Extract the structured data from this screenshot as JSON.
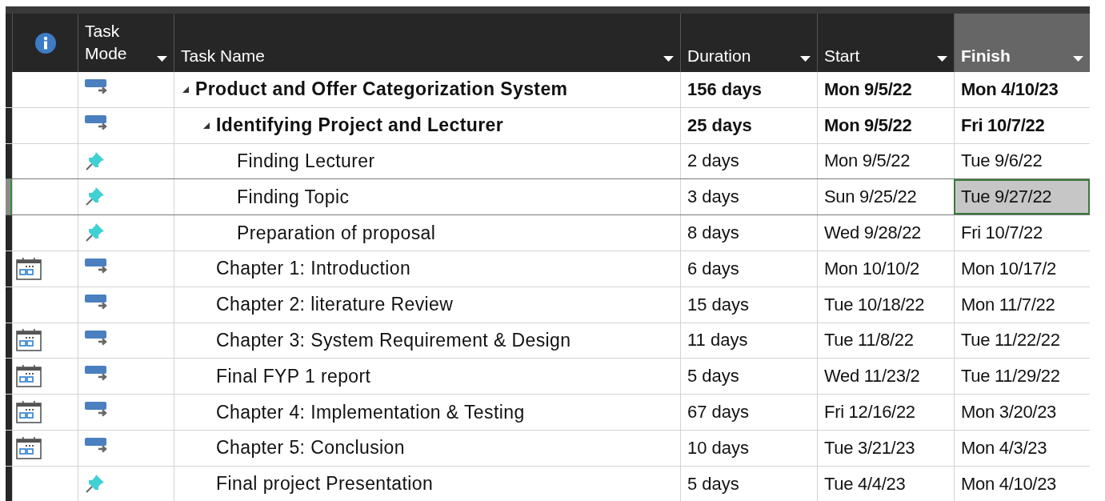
{
  "columns": [
    {
      "kind": "indicators",
      "selected": false
    },
    {
      "kind": "mode",
      "label": "Task Mode",
      "filter": true,
      "selected": false
    },
    {
      "kind": "name",
      "label": "Task Name",
      "filter": true,
      "selected": false
    },
    {
      "kind": "duration",
      "label": "Duration",
      "filter": true,
      "selected": false
    },
    {
      "kind": "start",
      "label": "Start",
      "filter": true,
      "selected": false
    },
    {
      "kind": "finish",
      "label": "Finish",
      "filter": true,
      "selected": true
    }
  ],
  "rows": [
    {
      "manual": false,
      "name": "Product and Offer Categorization System",
      "duration": "156 days",
      "start": "Mon 9/5/22",
      "finish": "Mon 4/10/23",
      "selected": false,
      "expanded": true,
      "children": [
        {
          "manual": false,
          "name": "Identifying Project and Lecturer",
          "duration": "25 days",
          "start": "Mon 9/5/22",
          "finish": "Fri 10/7/22",
          "selected": false,
          "expanded": true,
          "children": [
            {
              "manual": true,
              "name": "Finding Lecturer",
              "duration": "2 days",
              "start": "Mon 9/5/22",
              "finish": "Tue 9/6/22",
              "selected": false
            },
            {
              "manual": true,
              "name": "Finding Topic",
              "duration": "3 days",
              "start": "Sun 9/25/22",
              "finish": "Tue 9/27/22",
              "selected": true
            },
            {
              "manual": true,
              "name": "Preparation of proposal",
              "duration": "8 days",
              "start": "Wed 9/28/22",
              "finish": "Fri 10/7/22",
              "selected": false
            }
          ]
        },
        {
          "calendar": true,
          "manual": false,
          "name": "Chapter 1: Introduction",
          "duration": "6 days",
          "start": "Mon 10/10/2",
          "finish": "Mon 10/17/2",
          "selected": false
        },
        {
          "calendar": false,
          "manual": false,
          "name": "Chapter 2: literature Review",
          "duration": "15 days",
          "start": "Tue 10/18/22",
          "finish": "Mon 11/7/22",
          "selected": false
        },
        {
          "calendar": true,
          "manual": false,
          "name": "Chapter 3: System Requirement & Design",
          "duration": "11 days",
          "start": "Tue 11/8/22",
          "finish": "Tue 11/22/22",
          "selected": false
        },
        {
          "calendar": true,
          "manual": false,
          "name": "Final FYP 1 report",
          "duration": "5 days",
          "start": "Wed 11/23/2",
          "finish": "Tue 11/29/22",
          "selected": false
        },
        {
          "calendar": true,
          "manual": false,
          "name": "Chapter 4: Implementation & Testing",
          "duration": "67 days",
          "start": "Fri 12/16/22",
          "finish": "Mon 3/20/23",
          "selected": false
        },
        {
          "calendar": true,
          "manual": false,
          "name": "Chapter 5: Conclusion",
          "duration": "10 days",
          "start": "Tue 3/21/23",
          "finish": "Mon 4/3/23",
          "selected": false
        },
        {
          "calendar": false,
          "manual": true,
          "name": "Final project Presentation",
          "duration": "5 days",
          "start": "Tue 4/4/23",
          "finish": "Mon 4/10/23",
          "selected": false
        }
      ]
    }
  ]
}
